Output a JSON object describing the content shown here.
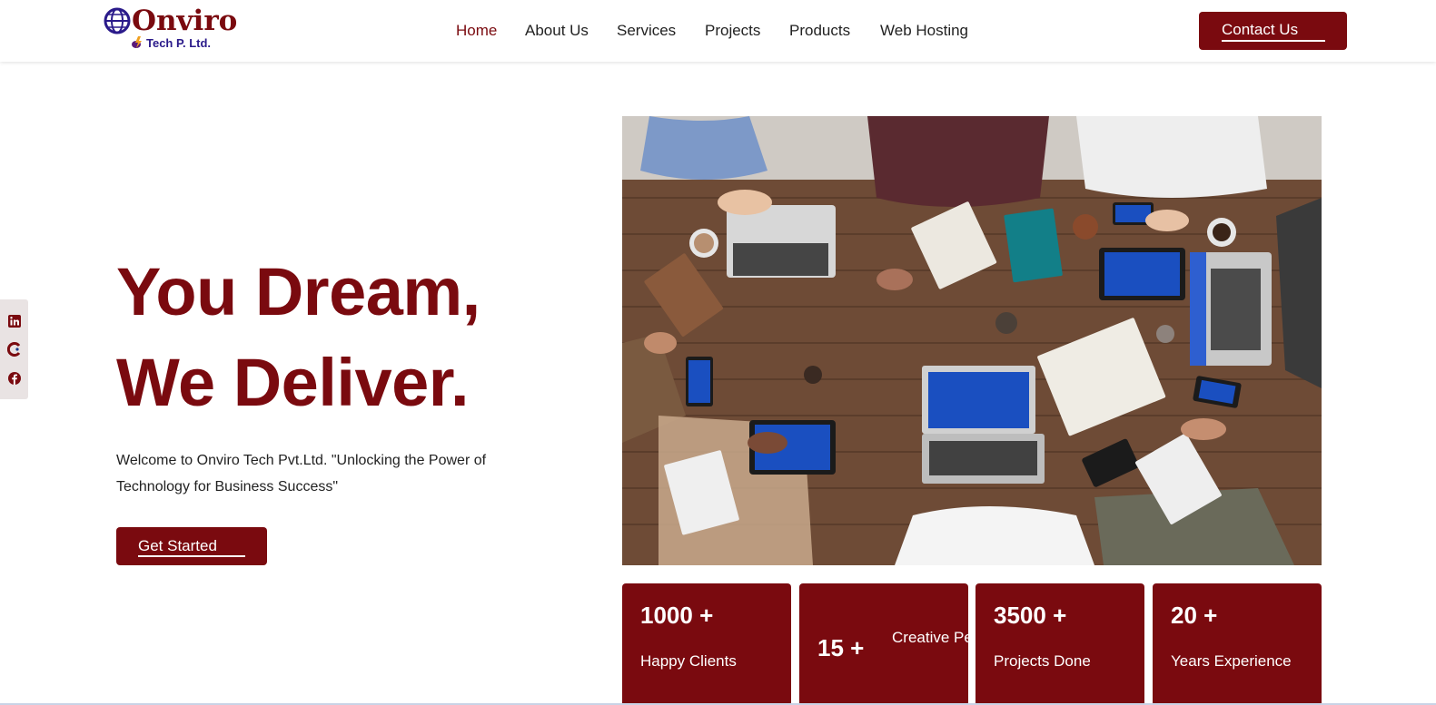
{
  "brand": {
    "name": "Onviro",
    "tagline": "Tech P. Ltd."
  },
  "nav": {
    "items": [
      {
        "label": "Home",
        "active": true
      },
      {
        "label": "About Us",
        "active": false
      },
      {
        "label": "Services",
        "active": false
      },
      {
        "label": "Projects",
        "active": false
      },
      {
        "label": "Products",
        "active": false
      },
      {
        "label": "Web Hosting",
        "active": false
      }
    ],
    "contact_label": "Contact Us"
  },
  "social": {
    "icons": [
      "linkedin-icon",
      "c-brand-icon",
      "facebook-icon"
    ]
  },
  "hero": {
    "title_line1": "You Dream,",
    "title_line2": "We Deliver.",
    "description": "Welcome to Onviro Tech Pvt.Ltd. \"Unlocking the Power of Technology for Business Success\"",
    "cta_label": "Get Started"
  },
  "stats": [
    {
      "number": "1000 +",
      "label": "Happy Clients"
    },
    {
      "number": "15 +",
      "label": "Creative People"
    },
    {
      "number": "3500 +",
      "label": "Projects Done"
    },
    {
      "number": "20 +",
      "label": "Years Experience"
    }
  ],
  "colors": {
    "brand": "#7a0a0f",
    "nav_text": "#222222",
    "background": "#ffffff"
  }
}
